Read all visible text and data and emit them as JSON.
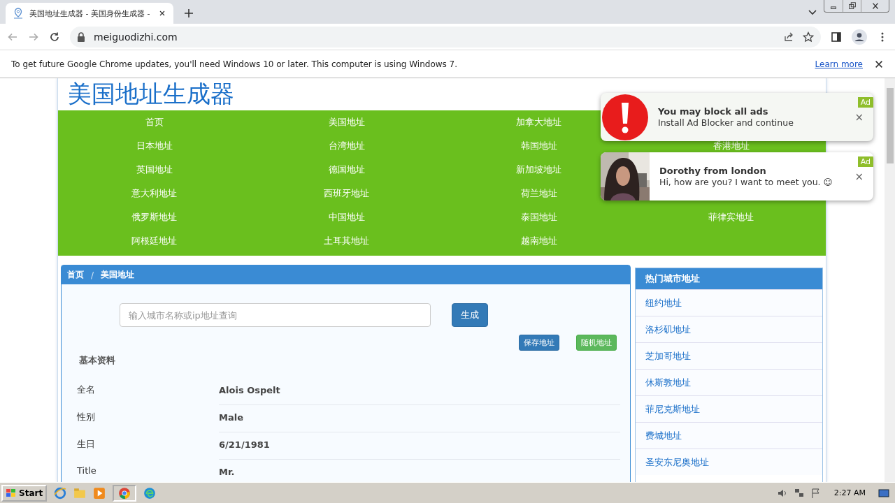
{
  "browser": {
    "tab_title": "美国地址生成器 - 美国身份生成器 -",
    "url": "meiguodizhi.com"
  },
  "infobar": {
    "message": "To get future Google Chrome updates, you'll need Windows 10 or later. This computer is using Windows 7.",
    "link": "Learn more"
  },
  "site": {
    "logo": "美国地址生成器"
  },
  "nav": [
    [
      "首页",
      "美国地址",
      "加拿大地址"
    ],
    [
      "日本地址",
      "台湾地址",
      "韩国地址",
      "香港地址"
    ],
    [
      "英国地址",
      "德国地址",
      "新加坡地址"
    ],
    [
      "意大利地址",
      "西班牙地址",
      "荷兰地址"
    ],
    [
      "俄罗斯地址",
      "中国地址",
      "泰国地址",
      "菲律宾地址"
    ],
    [
      "阿根廷地址",
      "土耳其地址",
      "越南地址"
    ]
  ],
  "breadcrumb": [
    "首页",
    "美国地址"
  ],
  "breadcrumb_separator": "/",
  "search": {
    "placeholder": "输入城市名称或ip地址查询",
    "button": "生成"
  },
  "actions": [
    {
      "label": "保存地址",
      "kind": "primary"
    },
    {
      "label": "随机地址",
      "kind": "success"
    }
  ],
  "section_title": "基本资料",
  "details": [
    {
      "label": "全名",
      "value": "Alois Ospelt"
    },
    {
      "label": "性别",
      "value": "Male"
    },
    {
      "label": "生日",
      "value": "6/21/1981"
    },
    {
      "label": "Title",
      "value": "Mr."
    }
  ],
  "sidebar": {
    "title": "热门城市地址",
    "links": [
      "纽约地址",
      "洛杉矶地址",
      "芝加哥地址",
      "休斯敦地址",
      "菲尼克斯地址",
      "费城地址",
      "圣安东尼奥地址"
    ]
  },
  "ads": [
    {
      "kind": "alert",
      "title": "You may block all ads",
      "text": "Install Ad Blocker and continue",
      "badge": "Ad",
      "close": "×"
    },
    {
      "title": "Dorothy from london",
      "text": "Hi, how are you? I want to meet you. ☺",
      "badge": "Ad",
      "close": "×"
    }
  ],
  "taskbar": {
    "start": "Start",
    "clock": "2:27 AM"
  }
}
